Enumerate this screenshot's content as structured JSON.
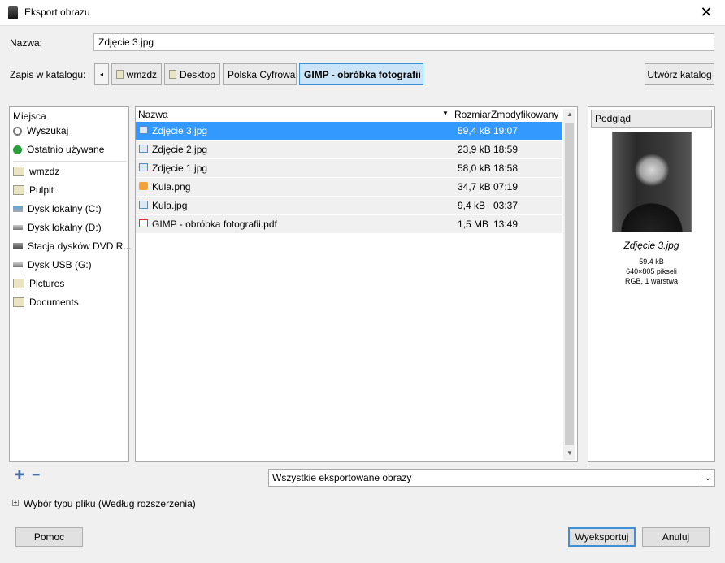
{
  "window": {
    "title": "Eksport obrazu",
    "close_glyph": "✕"
  },
  "name_row": {
    "label": "Nazwa:",
    "value": "Zdjęcie 3.jpg"
  },
  "folder_row": {
    "label": "Zapis w katalogu:",
    "back_glyph": "◂",
    "crumbs": [
      "wmzdz",
      "Desktop",
      "Polska Cyfrowa",
      "GIMP - obróbka fotografii"
    ],
    "mkdir_label": "Utwórz katalog"
  },
  "places": {
    "header": "Miejsca",
    "items": [
      {
        "label": "Wyszukaj",
        "icon": "search-icon"
      },
      {
        "label": "Ostatnio używane",
        "icon": "recent-icon"
      },
      {
        "label": "wmzdz",
        "icon": "folder-icon"
      },
      {
        "label": "Pulpit",
        "icon": "folder-icon"
      },
      {
        "label": "Dysk lokalny (C:)",
        "icon": "drive-icon"
      },
      {
        "label": "Dysk lokalny (D:)",
        "icon": "drive-icon"
      },
      {
        "label": "Stacja dysków DVD R...",
        "icon": "dvd-icon"
      },
      {
        "label": "Dysk USB (G:)",
        "icon": "usb-icon"
      },
      {
        "label": "Pictures",
        "icon": "folder-icon"
      },
      {
        "label": "Documents",
        "icon": "folder-icon"
      }
    ],
    "add_glyph": "✚",
    "remove_glyph": "━"
  },
  "filelist": {
    "columns": {
      "name": "Nazwa",
      "size": "Rozmiar",
      "modified": "Zmodyfikowany"
    },
    "sort_glyph": "▼",
    "rows": [
      {
        "name": "Zdjęcie 3.jpg",
        "size": "59,4 kB",
        "modified": "19:07",
        "icon": "image-icon"
      },
      {
        "name": "Zdjęcie 2.jpg",
        "size": "23,9 kB",
        "modified": "18:59",
        "icon": "image-icon"
      },
      {
        "name": "Zdjęcie 1.jpg",
        "size": "58,0 kB",
        "modified": "18:58",
        "icon": "image-icon"
      },
      {
        "name": "Kula.png",
        "size": "34,7 kB",
        "modified": "07:19",
        "icon": "png-icon"
      },
      {
        "name": "Kula.jpg",
        "size": "9,4 kB",
        "modified": "03:37",
        "icon": "image-icon"
      },
      {
        "name": "GIMP - obróbka fotografii.pdf",
        "size": "1,5 MB",
        "modified": "13:49",
        "icon": "pdf-icon"
      }
    ],
    "selected_index": 0,
    "scroll_up": "▲",
    "scroll_down": "▼"
  },
  "preview": {
    "button_label": "Podgląd",
    "filename": "Zdjęcie 3.jpg",
    "size": "59.4 kB",
    "dimensions": "640×805 pikseli",
    "mode": "RGB, 1 warstwa"
  },
  "filter": {
    "value": "Wszystkie eksportowane obrazy",
    "arrow": "⌄"
  },
  "filetype_expander": {
    "glyph": "+",
    "label": "Wybór typu pliku (Według rozszerzenia)"
  },
  "buttons": {
    "help": "Pomoc",
    "export": "Wyeksportuj",
    "cancel": "Anuluj"
  },
  "colors": {
    "selection": "#3399ff",
    "accent_border": "#3d8fd6"
  }
}
